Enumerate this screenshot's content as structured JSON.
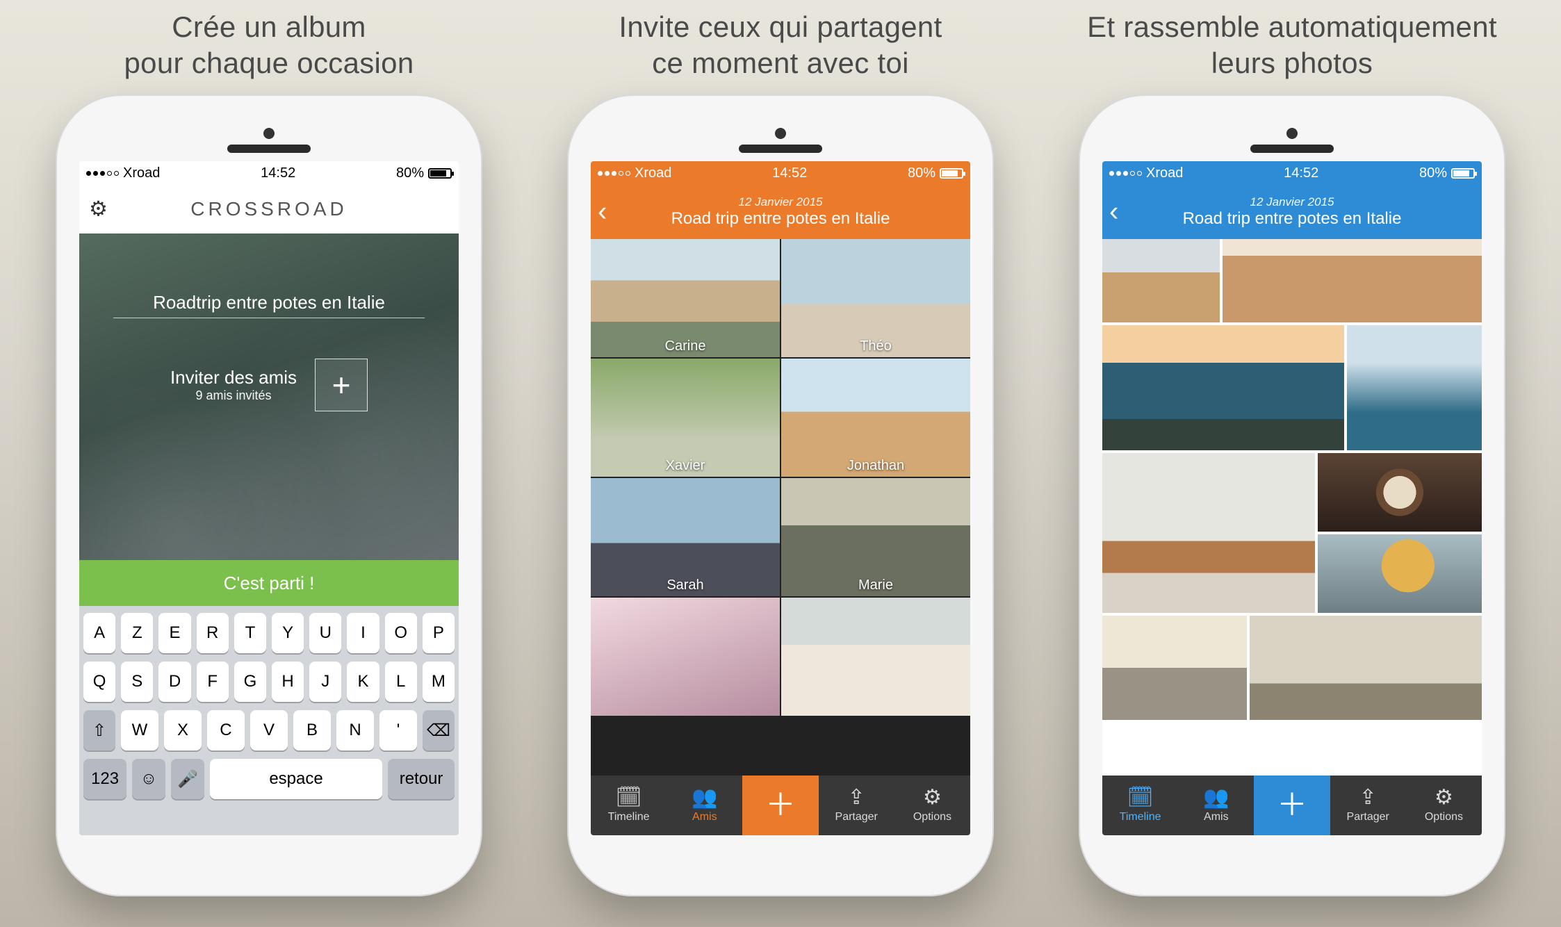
{
  "promos": {
    "p1": "Crée un album\npour chaque occasion",
    "p2": "Invite ceux qui partagent\nce moment avec toi",
    "p3": "Et rassemble automatiquement\nleurs photos"
  },
  "status": {
    "carrier": "Xroad",
    "time": "14:52",
    "battery": "80%"
  },
  "screen1": {
    "appTitle": "CROSSROAD",
    "albumName": "Roadtrip entre potes en Italie",
    "inviteTitle": "Inviter des amis",
    "inviteSub": "9 amis invités",
    "cta": "C'est parti !",
    "keyboard": {
      "row1": [
        "A",
        "Z",
        "E",
        "R",
        "T",
        "Y",
        "U",
        "I",
        "O",
        "P"
      ],
      "row2": [
        "Q",
        "S",
        "D",
        "F",
        "G",
        "H",
        "J",
        "K",
        "L",
        "M"
      ],
      "row3Shift": "⇧",
      "row3": [
        "W",
        "X",
        "C",
        "V",
        "B",
        "N",
        "'"
      ],
      "row3Del": "⌫",
      "numKey": "123",
      "emoji": "☺",
      "mic": "🎤",
      "space": "espace",
      "ret": "retour"
    }
  },
  "album": {
    "date": "12 Janvier 2015",
    "title": "Road trip entre potes en Italie"
  },
  "friends": [
    {
      "name": "Carine"
    },
    {
      "name": "Théo"
    },
    {
      "name": "Xavier"
    },
    {
      "name": "Jonathan"
    },
    {
      "name": "Sarah"
    },
    {
      "name": "Marie"
    }
  ],
  "tabs": {
    "timeline": "Timeline",
    "amis": "Amis",
    "partager": "Partager",
    "options": "Options"
  },
  "colors": {
    "orange": "#ec7a2b",
    "blue": "#2e8cd6",
    "green": "#7bbf4d"
  }
}
